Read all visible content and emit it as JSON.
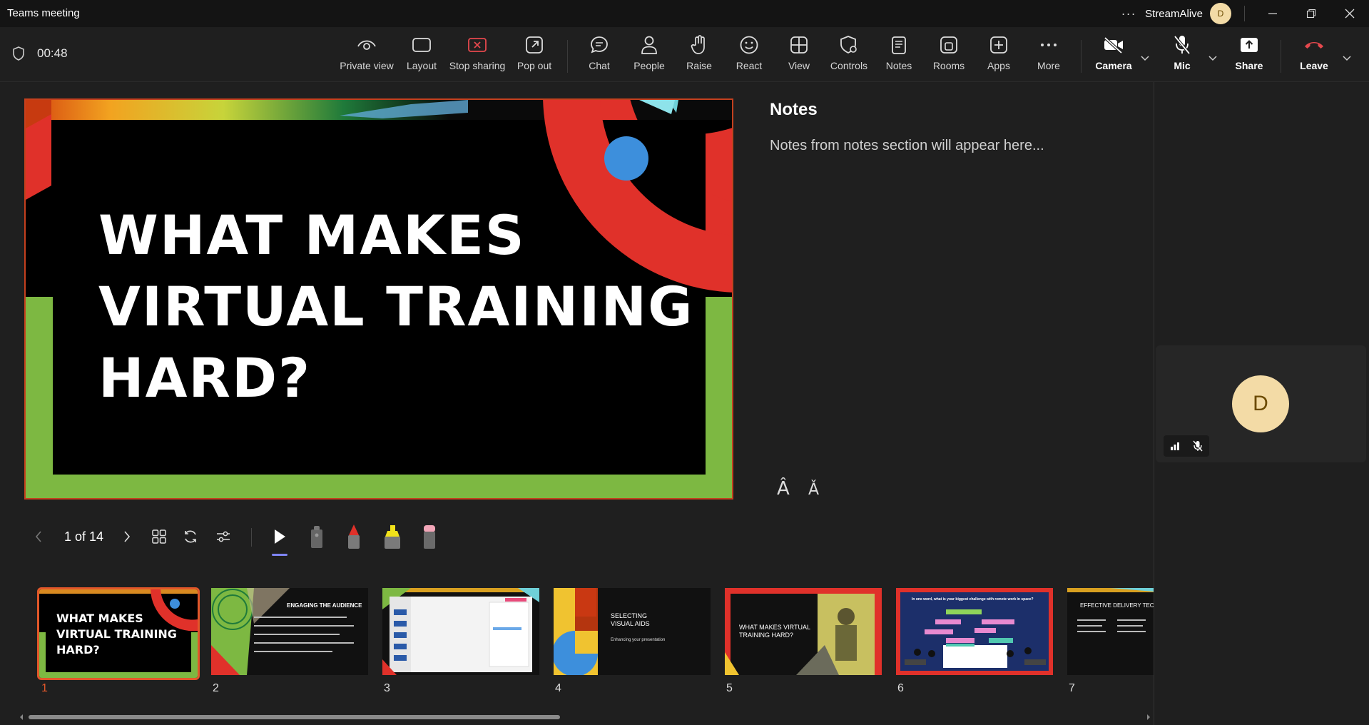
{
  "window": {
    "title": "Teams meeting",
    "user_name": "StreamAlive",
    "user_initial": "D",
    "more_label": "···"
  },
  "meeting": {
    "timer": "00:48"
  },
  "toolbar": {
    "private_view": "Private view",
    "layout": "Layout",
    "stop_sharing": "Stop sharing",
    "pop_out": "Pop out",
    "chat": "Chat",
    "people": "People",
    "raise": "Raise",
    "react": "React",
    "view": "View",
    "controls": "Controls",
    "notes": "Notes",
    "rooms": "Rooms",
    "apps": "Apps",
    "more": "More",
    "camera": "Camera",
    "mic": "Mic",
    "share": "Share",
    "leave": "Leave"
  },
  "slide": {
    "line1": "WHAT MAKES",
    "line2": "VIRTUAL TRAINING",
    "line3": "HARD?"
  },
  "notes": {
    "title": "Notes",
    "placeholder": "Notes from notes section will appear here..."
  },
  "font_controls": {
    "increase": "Â",
    "decrease": "Ǎ"
  },
  "participant": {
    "initial": "D"
  },
  "slide_controls": {
    "counter": "1 of 14"
  },
  "thumbnails": [
    {
      "num": "1",
      "title": "WHAT MAKES VIRTUAL TRAINING HARD?"
    },
    {
      "num": "2",
      "title": "ENGAGING THE AUDIENCE"
    },
    {
      "num": "3",
      "title": ""
    },
    {
      "num": "4",
      "title": "SELECTING VISUAL AIDS",
      "subtitle": "Enhancing your presentation"
    },
    {
      "num": "5",
      "title": "WHAT MAKES VIRTUAL TRAINING HARD?"
    },
    {
      "num": "6",
      "title": "In one word, what is your biggest challenge with remote work in space?"
    },
    {
      "num": "7",
      "title": "EFFECTIVE DELIVERY TECH"
    }
  ],
  "colors": {
    "accent": "#e2572a",
    "red": "#e0312a",
    "green": "#7db842",
    "blue": "#3d8fdc",
    "leave": "#e5484d",
    "pen_active": "#7f85f5"
  }
}
